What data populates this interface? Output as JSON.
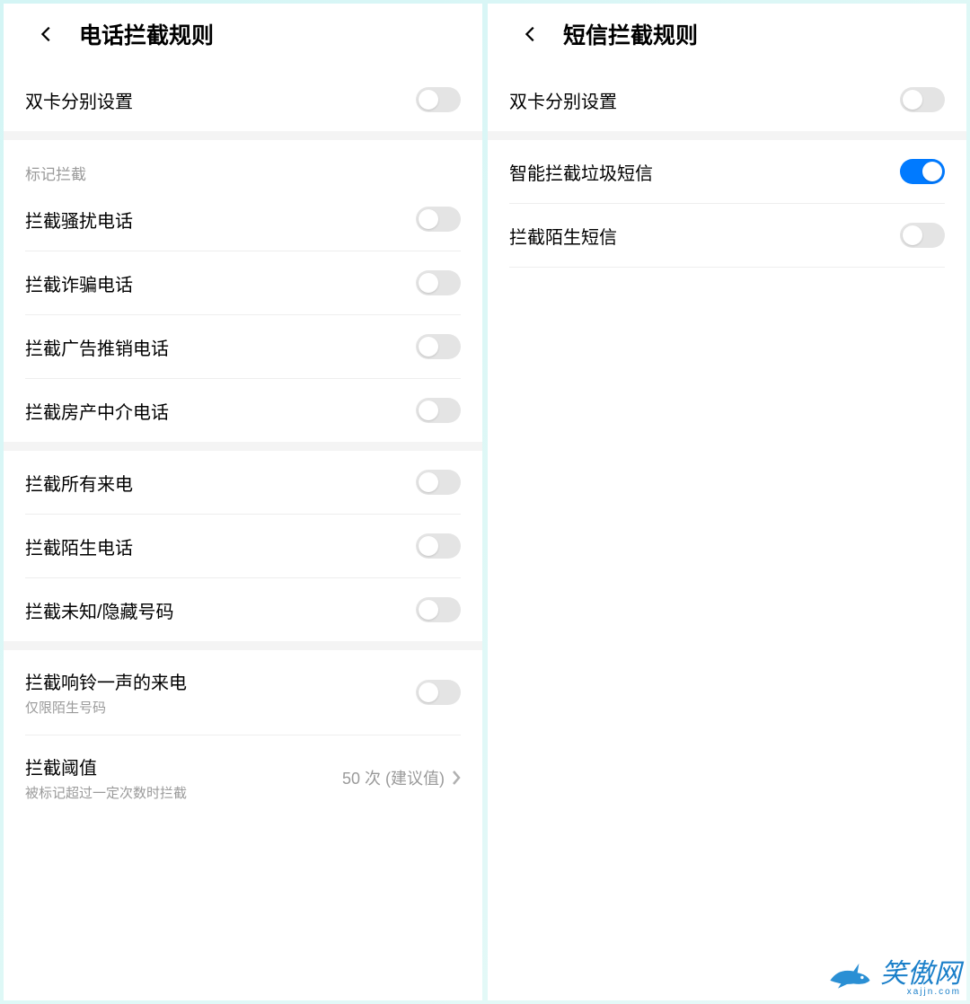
{
  "left": {
    "title": "电话拦截规则",
    "rows": {
      "dual_sim": {
        "label": "双卡分别设置",
        "on": false
      },
      "section_mark": "标记拦截",
      "harass": {
        "label": "拦截骚扰电话",
        "on": false
      },
      "fraud": {
        "label": "拦截诈骗电话",
        "on": false
      },
      "ads": {
        "label": "拦截广告推销电话",
        "on": false
      },
      "estate": {
        "label": "拦截房产中介电话",
        "on": false
      },
      "all_calls": {
        "label": "拦截所有来电",
        "on": false
      },
      "stranger": {
        "label": "拦截陌生电话",
        "on": false
      },
      "unknown": {
        "label": "拦截未知/隐藏号码",
        "on": false
      },
      "one_ring": {
        "label": "拦截响铃一声的来电",
        "sub": "仅限陌生号码",
        "on": false
      },
      "threshold": {
        "label": "拦截阈值",
        "sub": "被标记超过一定次数时拦截",
        "value": "50 次 (建议值)"
      }
    }
  },
  "right": {
    "title": "短信拦截规则",
    "rows": {
      "dual_sim": {
        "label": "双卡分别设置",
        "on": false
      },
      "smart_spam": {
        "label": "智能拦截垃圾短信",
        "on": true
      },
      "stranger_sms": {
        "label": "拦截陌生短信",
        "on": false
      }
    }
  },
  "watermark": {
    "text": "笑傲网",
    "sub": "xajjn.com"
  }
}
